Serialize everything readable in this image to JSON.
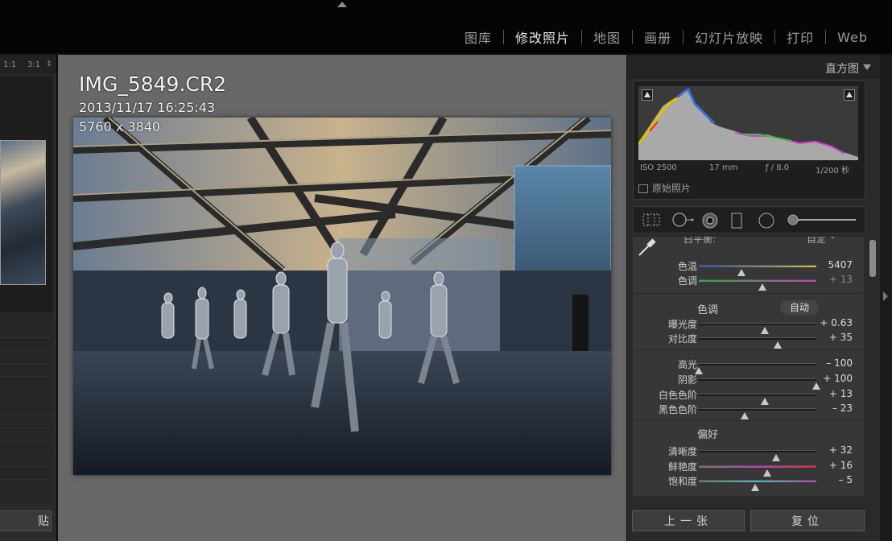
{
  "modules": [
    {
      "label": "图库",
      "active": false
    },
    {
      "label": "修改照片",
      "active": true
    },
    {
      "label": "地图",
      "active": false
    },
    {
      "label": "画册",
      "active": false
    },
    {
      "label": "幻灯片放映",
      "active": false
    },
    {
      "label": "打印",
      "active": false
    },
    {
      "label": "Web",
      "active": false
    }
  ],
  "left_panel": {
    "zoom_options": [
      "1:1",
      "3:1"
    ],
    "paste_label": "贴"
  },
  "photo": {
    "filename": "IMG_5849.CR2",
    "datetime": "2013/11/17 16:25:43",
    "dimensions": "5760 x 3840"
  },
  "histogram": {
    "title": "直方图",
    "iso": "ISO 2500",
    "focal": "17 mm",
    "aperture": "ƒ / 8.0",
    "shutter": "1/200 秒",
    "original_label": "原始照片"
  },
  "basic": {
    "wb_label": "白平衡:",
    "wb_value": "自定",
    "temp": {
      "label": "色温",
      "value": "5407",
      "pos": 0.36
    },
    "tint": {
      "label": "色调",
      "value": "+ 13",
      "pos": 0.54
    },
    "tone_header": "色调",
    "auto_label": "自动",
    "exposure": {
      "label": "曝光度",
      "value": "+ 0.63",
      "pos": 0.56
    },
    "contrast": {
      "label": "对比度",
      "value": "+ 35",
      "pos": 0.67
    },
    "highlights": {
      "label": "高光",
      "value": "– 100",
      "pos": 0.0
    },
    "shadows": {
      "label": "阴影",
      "value": "+ 100",
      "pos": 1.0
    },
    "whites": {
      "label": "白色色阶",
      "value": "+ 13",
      "pos": 0.56
    },
    "blacks": {
      "label": "黑色色阶",
      "value": "– 23",
      "pos": 0.39
    },
    "presence_header": "偏好",
    "clarity": {
      "label": "清晰度",
      "value": "+ 32",
      "pos": 0.66
    },
    "vibrance": {
      "label": "鲜艳度",
      "value": "+ 16",
      "pos": 0.58
    },
    "saturation": {
      "label": "饱和度",
      "value": "– 5",
      "pos": 0.48
    }
  },
  "buttons": {
    "previous": "上一张",
    "reset": "复位"
  }
}
